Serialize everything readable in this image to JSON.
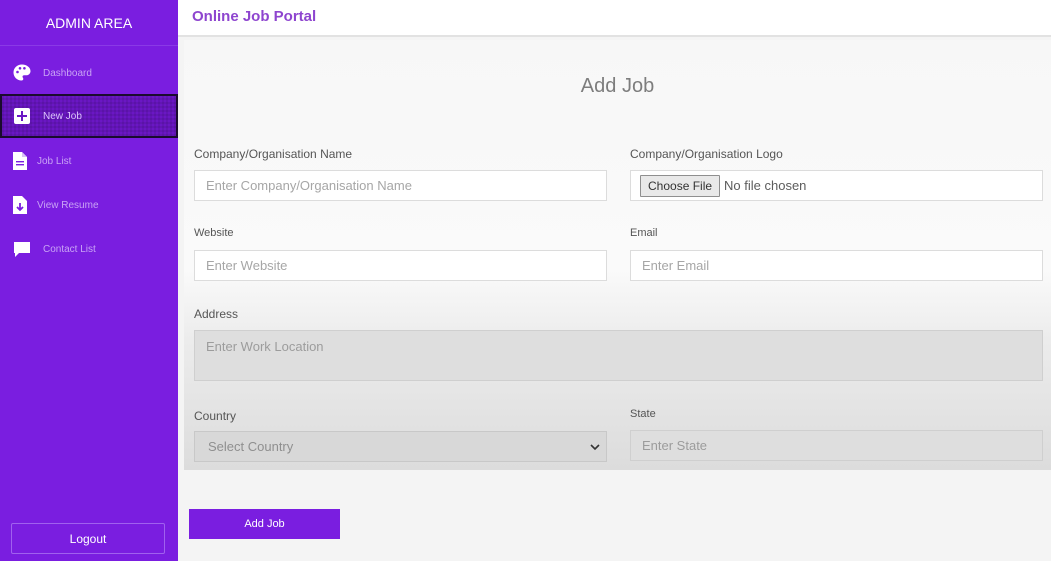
{
  "sidebar": {
    "title": "ADMIN AREA",
    "items": [
      {
        "label": "Dashboard",
        "icon": "palette-icon"
      },
      {
        "label": "New Job",
        "icon": "plus-square-icon"
      },
      {
        "label": "Job List",
        "icon": "document-icon"
      },
      {
        "label": "View Resume",
        "icon": "download-file-icon"
      },
      {
        "label": "Contact List",
        "icon": "chat-bubble-icon"
      }
    ],
    "active_item": "New Job",
    "logout_label": "Logout"
  },
  "header": {
    "title": "Online Job Portal"
  },
  "form": {
    "title": "Add Job",
    "company_name": {
      "label": "Company/Organisation Name",
      "placeholder": "Enter Company/Organisation Name"
    },
    "company_logo": {
      "label": "Company/Organisation Logo",
      "button": "Choose File",
      "status": "No file chosen"
    },
    "website": {
      "label": "Website",
      "placeholder": "Enter Website"
    },
    "email": {
      "label": "Email",
      "placeholder": "Enter Email"
    },
    "address": {
      "label": "Address",
      "placeholder": "Enter Work Location"
    },
    "country": {
      "label": "Country",
      "selected": "Select Country"
    },
    "state": {
      "label": "State",
      "placeholder": "Enter State"
    },
    "submit_label": "Add Job"
  },
  "colors": {
    "brand": "#7a1ee0",
    "header_title": "#8e45cf"
  }
}
